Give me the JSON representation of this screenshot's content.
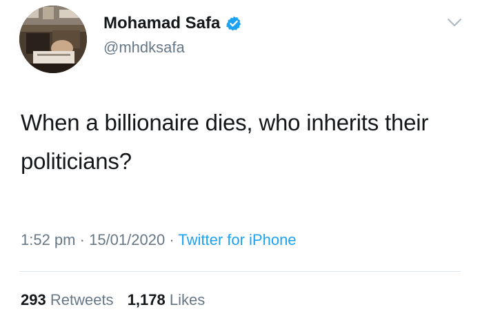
{
  "author": {
    "display_name": "Mohamad Safa",
    "handle": "@mhdksafa",
    "verified": true,
    "avatar_icon": "profile-photo"
  },
  "tweet": {
    "text": "When a billionaire dies, who inherits their politicians?",
    "time": "1:52 pm",
    "date": "15/01/2020",
    "source": "Twitter for iPhone",
    "separator": "·"
  },
  "stats": {
    "retweets_count": "293",
    "retweets_label": "Retweets",
    "likes_count": "1,178",
    "likes_label": "Likes"
  },
  "colors": {
    "text": "#14171a",
    "secondary": "#657786",
    "accent": "#1da1f2",
    "divider": "#e1e8ed"
  }
}
